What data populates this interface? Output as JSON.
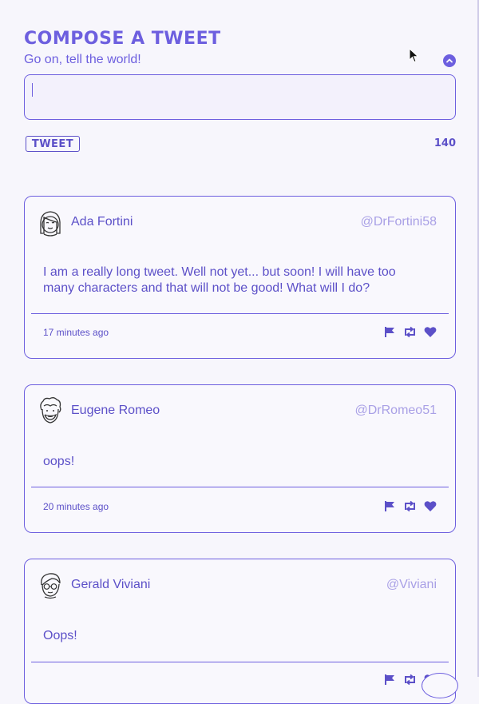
{
  "compose": {
    "title": "COMPOSE A TWEET",
    "subtitle": "Go on, tell the world!",
    "input_value": "",
    "tweet_button": "TWEET",
    "char_count": "140"
  },
  "tweets": [
    {
      "author": "Ada Fortini",
      "handle": "@DrFortini58",
      "text": "I am a really long tweet. Well not yet... but soon! I will have too many characters and that will not be good! What will I do?",
      "time": "17 minutes ago"
    },
    {
      "author": "Eugene Romeo",
      "handle": "@DrRomeo51",
      "text": "oops!",
      "time": "20 minutes ago"
    },
    {
      "author": "Gerald Viviani",
      "handle": "@Viviani",
      "text": "Oops!",
      "time": ""
    }
  ],
  "icons": {
    "collapse": "chevron-up-icon",
    "flag": "flag-icon",
    "retweet": "retweet-icon",
    "like": "heart-icon"
  },
  "colors": {
    "accent": "#6d5fdf",
    "text": "#5c50c8",
    "handle": "#a9a0e6",
    "background": "#f7f6fc"
  }
}
